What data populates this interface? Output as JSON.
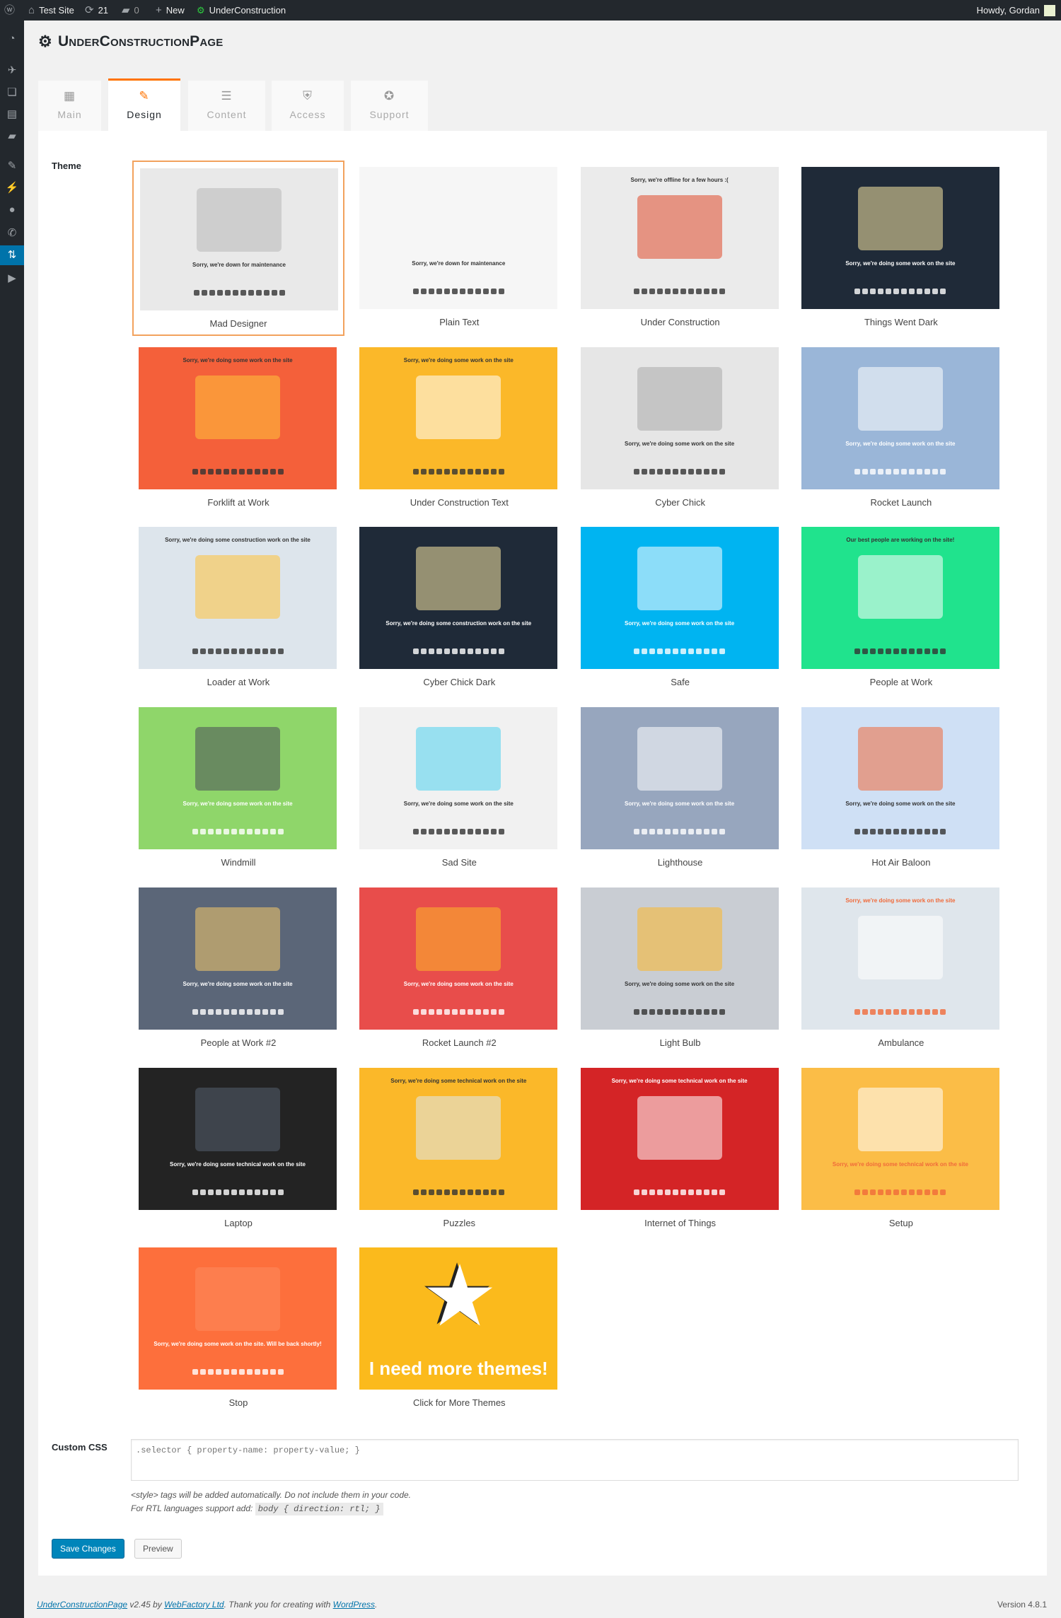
{
  "adminbar": {
    "site": "Test Site",
    "updates": "21",
    "comments": "0",
    "new": "New",
    "plugin": "UnderConstruction",
    "howdy": "Howdy, Gordan"
  },
  "sidebar": {
    "icons": [
      "dashboard-icon",
      "pin-icon",
      "media-icon",
      "pages-icon",
      "comments-icon",
      "appearance-icon",
      "plugins-icon",
      "users-icon",
      "tools-icon",
      "settings-icon",
      "play-icon"
    ],
    "active": 9
  },
  "page_title": "UnderConstructionPage",
  "tabs": [
    {
      "label": "Main",
      "icon": "▦"
    },
    {
      "label": "Design",
      "icon": "✎"
    },
    {
      "label": "Content",
      "icon": "☰"
    },
    {
      "label": "Access",
      "icon": "⛨"
    },
    {
      "label": "Support",
      "icon": "✪"
    }
  ],
  "active_tab": 1,
  "theme_label": "Theme",
  "themes": [
    {
      "name": "Mad Designer",
      "headline": "Sorry, we're down for maintenance",
      "bg": "#e9e9e9",
      "fg": "#333",
      "accent": "#b8b8b8"
    },
    {
      "name": "Plain Text",
      "headline": "Sorry, we're down for maintenance",
      "bg": "#f6f6f6",
      "fg": "#333",
      "accent": "#f6f6f6"
    },
    {
      "name": "Under Construction",
      "headline": "Sorry, we're offline for a few hours :(",
      "bg": "#ebebeb",
      "fg": "#333",
      "accent": "#e04b2c"
    },
    {
      "name": "Things Went Dark",
      "headline": "Sorry, we're doing some work on the site",
      "bg": "#1f2a38",
      "fg": "#fff",
      "accent": "#f5e3a3"
    },
    {
      "name": "Forklift at Work",
      "headline": "Sorry, we're doing some work on the site",
      "bg": "#f4603a",
      "fg": "#333",
      "accent": "#ffc33b"
    },
    {
      "name": "Under Construction Text",
      "headline": "Sorry, we're doing some work on the site",
      "bg": "#fbb829",
      "fg": "#333",
      "accent": "#ffffff"
    },
    {
      "name": "Cyber Chick",
      "headline": "Sorry, we're doing some work on the site",
      "bg": "#e6e6e6",
      "fg": "#333",
      "accent": "#aaaaaa"
    },
    {
      "name": "Rocket Launch",
      "headline": "Sorry, we're doing some work on the site",
      "bg": "#9ab6d8",
      "fg": "#fff",
      "accent": "#ffffff"
    },
    {
      "name": "Loader at Work",
      "headline": "Sorry, we're doing some construction work on the site",
      "bg": "#dde5ec",
      "fg": "#333",
      "accent": "#ffc33b"
    },
    {
      "name": "Cyber Chick Dark",
      "headline": "Sorry, we're doing some construction work on the site",
      "bg": "#1f2a38",
      "fg": "#fff",
      "accent": "#f5e3a3"
    },
    {
      "name": "Safe",
      "headline": "Sorry, we're doing some work on the site",
      "bg": "#00b4f1",
      "fg": "#fff",
      "accent": "#ffffff"
    },
    {
      "name": "People at Work",
      "headline": "Our best people are working on the site!",
      "bg": "#20e38d",
      "fg": "#333",
      "accent": "#ffffff"
    },
    {
      "name": "Windmill",
      "headline": "Sorry, we're doing some work on the site",
      "bg": "#8fd66a",
      "fg": "#fff",
      "accent": "#4a4f57"
    },
    {
      "name": "Sad Site",
      "headline": "Sorry, we're doing some work on the site",
      "bg": "#f1f1f1",
      "fg": "#333",
      "accent": "#4fd1ee"
    },
    {
      "name": "Lighthouse",
      "headline": "Sorry, we're doing some work on the site",
      "bg": "#97a6be",
      "fg": "#fff",
      "accent": "#ffffff"
    },
    {
      "name": "Hot Air Baloon",
      "headline": "Sorry, we're doing some work on the site",
      "bg": "#cfe0f5",
      "fg": "#333",
      "accent": "#f06a3a"
    },
    {
      "name": "People at Work #2",
      "headline": "Sorry, we're doing some work on the site",
      "bg": "#5b6678",
      "fg": "#fff",
      "accent": "#f4c96a"
    },
    {
      "name": "Rocket Launch #2",
      "headline": "Sorry, we're doing some work on the site",
      "bg": "#e84d4b",
      "fg": "#fff",
      "accent": "#fbb829"
    },
    {
      "name": "Light Bulb",
      "headline": "Sorry, we're doing some work on the site",
      "bg": "#c9cdd3",
      "fg": "#333",
      "accent": "#fbb829"
    },
    {
      "name": "Ambulance",
      "headline": "Sorry, we're doing some work on the site",
      "bg": "#dfe6ec",
      "fg": "#f06a3a",
      "accent": "#ffffff"
    },
    {
      "name": "Laptop",
      "headline": "Sorry, we're doing some technical work on the site",
      "bg": "#232323",
      "fg": "#fff",
      "accent": "#556070"
    },
    {
      "name": "Puzzles",
      "headline": "Sorry, we're doing some technical work on the site",
      "bg": "#fbb829",
      "fg": "#333",
      "accent": "#dfe9f3"
    },
    {
      "name": "Internet of Things",
      "headline": "Sorry, we're doing some technical work on the site",
      "bg": "#d42426",
      "fg": "#fff",
      "accent": "#ffffff"
    },
    {
      "name": "Setup",
      "headline": "Sorry, we're doing some technical work on the site",
      "bg": "#fbbd47",
      "fg": "#f06a3a",
      "accent": "#ffffff"
    },
    {
      "name": "Stop",
      "headline": "Sorry, we're doing some work on the site. Will be back shortly!",
      "bg": "#fd6f3c",
      "fg": "#fff",
      "accent": "#fd8a5c"
    },
    {
      "name": "Click for More Themes",
      "headline": "I need more themes!",
      "bg": "#fbba1c",
      "fg": "#fff",
      "accent": "#ffffff"
    }
  ],
  "selected_theme": 0,
  "custom_css": {
    "label": "Custom CSS",
    "placeholder": ".selector { property-name: property-value; }",
    "help1": "<style> tags will be added automatically. Do not include them in your code.",
    "help2": "For RTL languages support add:",
    "help2_code": "body { direction: rtl; }"
  },
  "buttons": {
    "save": "Save Changes",
    "preview": "Preview"
  },
  "footer": {
    "plugin_link": "UnderConstructionPage",
    "by": " v2.45 by ",
    "company_link": "WebFactory Ltd",
    "thanks": ". Thank you for creating with ",
    "wp_link": "WordPress",
    "end": ".",
    "version": "Version 4.8.1"
  }
}
